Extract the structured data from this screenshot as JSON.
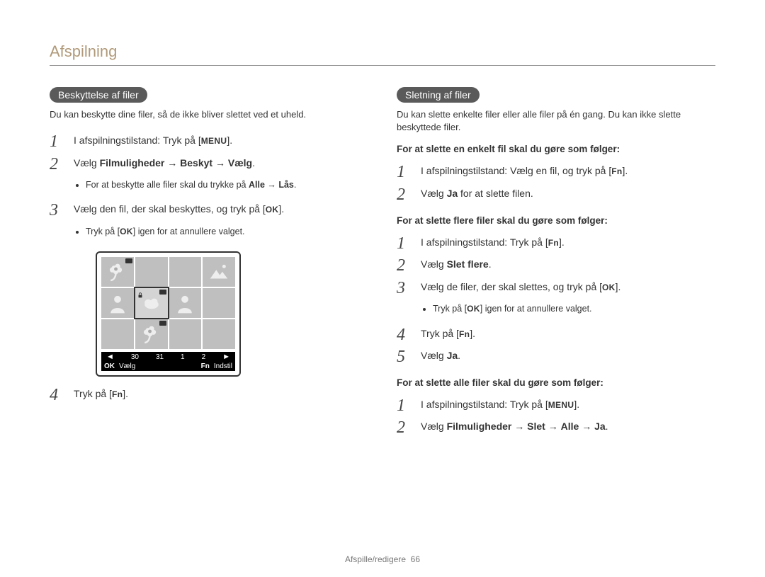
{
  "header": "Afspilning",
  "footer": {
    "section": "Afspille/redigere",
    "page": "66"
  },
  "keys": {
    "MENU": "MENU",
    "OK": "OK",
    "Fn": "Fn"
  },
  "left": {
    "pill": "Beskyttelse af filer",
    "intro": "Du kan beskytte dine filer, så de ikke bliver slettet ved et uheld.",
    "steps": [
      {
        "n": "1",
        "pre": "I afspilningstilstand: Tryk på [",
        "key": "MENU",
        "post": "]."
      },
      {
        "n": "2",
        "rich": "Vælg <b>Filmuligheder</b> → <b>Beskyt</b> → <b>Vælg</b>.",
        "bullets": [
          {
            "pre": "For at beskytte alle filer skal du trykke på ",
            "bold": "Alle → Lås",
            "post": "."
          }
        ]
      },
      {
        "n": "3",
        "pre": "Vælg den fil, der skal beskyttes, og tryk på [",
        "key": "OK",
        "post": "].",
        "bullets": [
          {
            "pre": "Tryk på [",
            "key": "OK",
            "post": "] igen for at annullere valget."
          }
        ]
      },
      {
        "n": "4",
        "pre": "Tryk på [",
        "key": "Fn",
        "post": "]."
      }
    ],
    "figure": {
      "dates": [
        "30",
        "31",
        "1",
        "2"
      ],
      "bar": {
        "okLabel": "Vælg",
        "fnLabel": "Indstil",
        "ok": "OK",
        "fn": "Fn"
      }
    }
  },
  "right": {
    "pill": "Sletning af filer",
    "intro": "Du kan slette enkelte filer eller alle filer på én gang. Du kan ikke slette beskyttede filer.",
    "sub_single": "For at slette en enkelt fil skal du gøre som følger:",
    "steps_single": [
      {
        "n": "1",
        "pre": "I afspilningstilstand: Vælg en fil, og tryk på [",
        "key": "Fn",
        "post": "]."
      },
      {
        "n": "2",
        "rich": "Vælg <b>Ja</b> for at slette filen."
      }
    ],
    "sub_multi": "For at slette flere filer skal du gøre som følger:",
    "steps_multi": [
      {
        "n": "1",
        "pre": "I afspilningstilstand: Tryk på [",
        "key": "Fn",
        "post": "]."
      },
      {
        "n": "2",
        "rich": "Vælg <b>Slet flere</b>."
      },
      {
        "n": "3",
        "pre": "Vælg de filer, der skal slettes, og tryk på [",
        "key": "OK",
        "post": "].",
        "bullets": [
          {
            "pre": "Tryk på [",
            "key": "OK",
            "post": "] igen for at annullere valget."
          }
        ]
      },
      {
        "n": "4",
        "pre": "Tryk på [",
        "key": "Fn",
        "post": "]."
      },
      {
        "n": "5",
        "rich": "Vælg <b>Ja</b>."
      }
    ],
    "sub_all": "For at slette alle filer skal du gøre som følger:",
    "steps_all": [
      {
        "n": "1",
        "pre": "I afspilningstilstand: Tryk på [",
        "key": "MENU",
        "post": "]."
      },
      {
        "n": "2",
        "rich": "Vælg <b>Filmuligheder</b> → <b>Slet</b> → <b>Alle</b> → <b>Ja</b>."
      }
    ]
  }
}
